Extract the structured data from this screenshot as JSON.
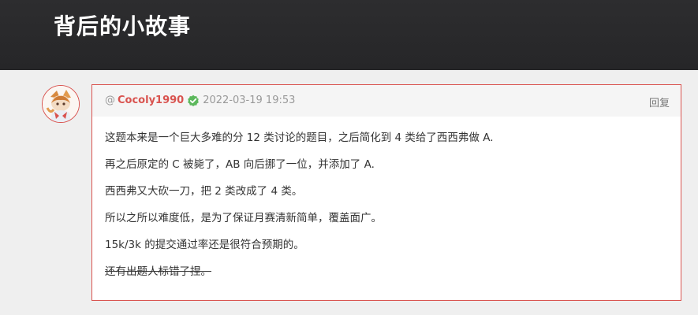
{
  "page": {
    "title": "背后的小故事"
  },
  "comment": {
    "at": "@",
    "username": "Cocoly1990",
    "date": "2022-03-19 19:53",
    "reply_label": "回复",
    "paragraphs": [
      "这题本来是一个巨大多难的分 12 类讨论的题目，之后简化到 4 类给了西西弗做 A.",
      "再之后原定的 C 被毙了，AB 向后挪了一位，并添加了 A.",
      "西西弗又大砍一刀，把 2 类改成了 4 类。",
      "所以之所以难度低，是为了保证月赛清新简单，覆盖面广。",
      "15k/3k 的提交通过率还是很符合预期的。",
      "还有出题人标错了捏。"
    ],
    "strikethrough_paragraph": 6
  },
  "colors": {
    "header_bg": "#2b2b2d",
    "accent": "#d9534f",
    "verified": "#5cb85c",
    "page_bg": "#efefef"
  },
  "icons": {
    "avatar": "anime-avatar",
    "verified": "check-badge-icon"
  }
}
